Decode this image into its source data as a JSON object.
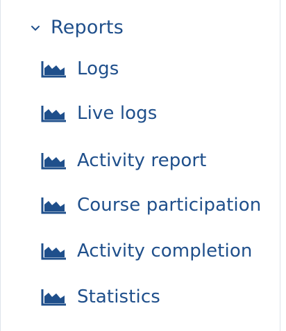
{
  "nav": {
    "section": {
      "label": "Reports",
      "icon": "chevron-down-icon",
      "expanded": true
    },
    "items": [
      {
        "label": "Logs",
        "icon": "area-chart-icon"
      },
      {
        "label": "Live logs",
        "icon": "area-chart-icon"
      },
      {
        "label": "Activity report",
        "icon": "area-chart-icon"
      },
      {
        "label": "Course participation",
        "icon": "area-chart-icon"
      },
      {
        "label": "Activity completion",
        "icon": "area-chart-icon"
      },
      {
        "label": "Statistics",
        "icon": "area-chart-icon"
      }
    ]
  },
  "colors": {
    "link": "#1f4f8b",
    "border": "#dde3ea",
    "background": "#ffffff"
  }
}
